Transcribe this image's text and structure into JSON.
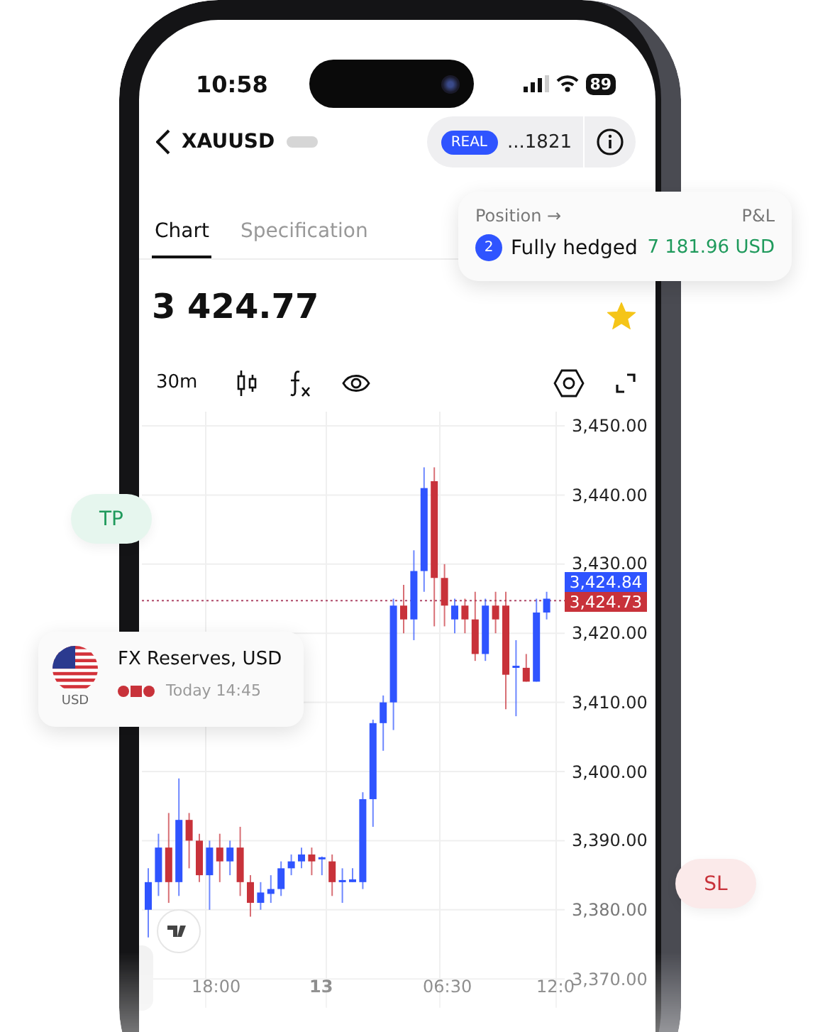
{
  "status_bar": {
    "time": "10:58",
    "battery": "89"
  },
  "header": {
    "symbol": "XAUUSD",
    "account": {
      "type": "REAL",
      "number": "...1821"
    }
  },
  "tabs": [
    {
      "label": "Chart",
      "selected": true
    },
    {
      "label": "Specification",
      "selected": false
    }
  ],
  "price": "3 424.77",
  "favorite": true,
  "toolbar": {
    "timeframe": "30m"
  },
  "chart": {
    "chart_data": {
      "type": "candlestick",
      "categories": [
        null,
        null,
        null,
        null,
        null,
        null,
        null,
        null,
        null,
        null,
        null,
        null,
        null,
        null,
        null,
        null,
        null,
        null,
        null,
        null,
        null,
        null,
        null,
        null,
        null,
        null,
        null,
        null,
        null,
        null,
        null,
        null,
        null,
        null,
        null,
        null,
        null,
        null,
        null,
        null
      ],
      "grid": true,
      "ylim": [
        3370,
        3450
      ],
      "ref_lines": [
        {
          "axis": "y",
          "value": 3424.73,
          "label": "3,424.73",
          "color": "#b04a6a"
        }
      ],
      "yticks": [
        {
          "value": 3450,
          "label": "3,450.00"
        },
        {
          "value": 3440,
          "label": "3,440.00"
        },
        {
          "value": 3430,
          "label": "3,430.00"
        },
        {
          "value": 3420,
          "label": "3,420.00"
        },
        {
          "value": 3410,
          "label": "3,410.00"
        },
        {
          "value": 3400,
          "label": "3,400.00"
        },
        {
          "value": 3390,
          "label": "3,390.00"
        },
        {
          "value": 3380,
          "label": "3,380.00"
        },
        {
          "value": 3370,
          "label": "3,370.00"
        }
      ],
      "ohlc": [
        [
          3380,
          3386,
          3376,
          3384
        ],
        [
          3384,
          3391,
          3382,
          3389
        ],
        [
          3389,
          3394,
          3381,
          3384
        ],
        [
          3384,
          3399,
          3382,
          3393
        ],
        [
          3393,
          3394,
          3386,
          3390
        ],
        [
          3390,
          3391,
          3384,
          3385
        ],
        [
          3385,
          3390,
          3380,
          3389
        ],
        [
          3389,
          3391,
          3384,
          3387
        ],
        [
          3387,
          3390,
          3385,
          3389
        ],
        [
          3389,
          3392,
          3382,
          3384
        ],
        [
          3384,
          3385,
          3379,
          3381
        ],
        [
          3381,
          3384,
          3380,
          3382.5
        ],
        [
          3382.3,
          3385,
          3381,
          3383
        ],
        [
          3383,
          3387,
          3382,
          3386
        ],
        [
          3386,
          3388,
          3385,
          3387
        ],
        [
          3387,
          3389,
          3386,
          3388
        ],
        [
          3388,
          3389,
          3385,
          3387
        ],
        [
          3387.3,
          3387.7,
          3385,
          3387.6
        ],
        [
          3387,
          3388,
          3382,
          3384
        ],
        [
          3384,
          3386,
          3381,
          3384.3
        ],
        [
          3384,
          3386,
          3384,
          3384.4
        ],
        [
          3384,
          3397,
          3383,
          3396
        ],
        [
          3396,
          3407.5,
          3392,
          3407
        ],
        [
          3407,
          3411,
          3403,
          3410
        ],
        [
          3410,
          3425,
          3406,
          3424
        ],
        [
          3424,
          3427,
          3420,
          3422
        ],
        [
          3422,
          3432,
          3419,
          3429
        ],
        [
          3429,
          3444,
          3426,
          3441
        ],
        [
          3442,
          3444,
          3421,
          3428
        ],
        [
          3428,
          3430,
          3421,
          3424
        ],
        [
          3422,
          3425,
          3420,
          3424
        ],
        [
          3424,
          3425,
          3420,
          3422
        ],
        [
          3422,
          3426,
          3416,
          3417
        ],
        [
          3417,
          3425,
          3416,
          3424
        ],
        [
          3424,
          3426,
          3420,
          3422
        ],
        [
          3424,
          3426,
          3409,
          3414
        ],
        [
          3415,
          3419,
          3408,
          3415.3
        ],
        [
          3415,
          3417,
          3413,
          3413
        ],
        [
          3413,
          3425,
          3413,
          3423
        ],
        [
          3423,
          3426,
          3422,
          3425
        ]
      ]
    },
    "time_labels": [
      "18:00",
      "13",
      "06:30",
      "12:0"
    ],
    "ask": "3,424.84"
  },
  "position_card": {
    "title": "Position →",
    "pnl_label": "P&L",
    "count": "2",
    "status": "Fully hedged",
    "pnl": "7 181.96 USD"
  },
  "take_profit": "TP",
  "stop_loss": "SL",
  "event_card": {
    "currency": "USD",
    "title": "FX Reserves, USD",
    "time": "Today 14:45"
  }
}
